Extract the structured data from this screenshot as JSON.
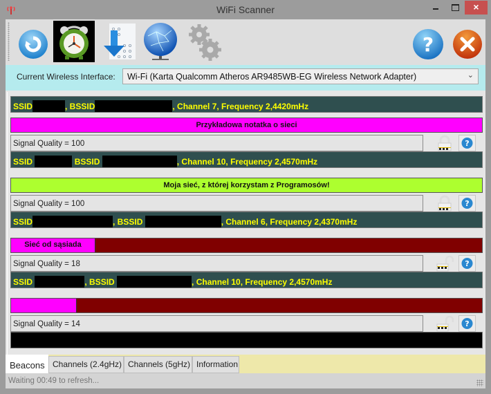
{
  "window": {
    "title": "WiFi Scanner",
    "close_glyph": "×"
  },
  "toolbar": {
    "buttons": [
      {
        "name": "refresh",
        "icon": "refresh-icon"
      },
      {
        "name": "auto-refresh-timer",
        "icon": "alarm-clock-icon"
      },
      {
        "name": "export",
        "icon": "download-icon"
      },
      {
        "name": "network",
        "icon": "globe-icon"
      },
      {
        "name": "settings",
        "icon": "gears-icon"
      },
      {
        "name": "help",
        "icon": "help-icon"
      },
      {
        "name": "exit",
        "icon": "exit-icon"
      }
    ]
  },
  "interface": {
    "label": "Current Wireless Interface:",
    "selected": "Wi-Fi (Karta Qualcomm Atheros AR9485WB-EG Wireless Network Adapter)"
  },
  "networks": [
    {
      "ssid_label": "SSID",
      "bssid_label": ", BSSID",
      "tail": ", Channel 7, Frequency 2,4420mHz",
      "channel": 7,
      "frequency": "2,4420mHz"
    },
    {
      "note": "Przykładowa notatka o sieci",
      "note_color": "#ff00ff",
      "note_style": "full",
      "signal_text": "Signal Quality = 100",
      "signal_quality": 100,
      "lock": "locked",
      "ssid_label": "SSID",
      "bssid_label": "BSSID",
      "tail": ", Channel 10, Frequency 2,4570mHz",
      "channel": 10,
      "frequency": "2,4570mHz"
    },
    {
      "note": "Moja sieć, z której korzystam z Programosów!",
      "note_color": "#adff2f",
      "note_style": "full",
      "signal_text": "Signal Quality = 100",
      "signal_quality": 100,
      "lock": "locked",
      "ssid_label": "SSID",
      "bssid_label": ", BSSID",
      "tail": ", Channel 6, Frequency 2,4370mHz",
      "channel": 6,
      "frequency": "2,4370mHz"
    },
    {
      "note": "Sieć od sąsiada",
      "note_color": "#ff00ff",
      "note_bg": "#800000",
      "note_style": "chip",
      "signal_text": "Signal Quality = 18",
      "signal_quality": 18,
      "lock": "unlocked",
      "ssid_label": "SSID",
      "bssid_label": ", BSSID",
      "tail": ", Channel 10, Frequency 2,4570mHz",
      "channel": 10,
      "frequency": "2,4570mHz"
    },
    {
      "note": "",
      "note_color": "#ff00ff",
      "note_bg": "#800000",
      "note_style": "chip",
      "signal_text": "Signal Quality = 14",
      "signal_quality": 14,
      "lock": "unlocked"
    }
  ],
  "tabs": [
    {
      "label": "Beacons",
      "active": true
    },
    {
      "label": "Channels (2.4gHz)",
      "active": false
    },
    {
      "label": "Channels (5gHz)",
      "active": false
    },
    {
      "label": "Information",
      "active": false
    }
  ],
  "status": {
    "text": "Waiting 00:49 to refresh..."
  },
  "colors": {
    "info_bar_bg": "#2f4f4f",
    "info_bar_text": "#ffff00",
    "interface_bar_bg": "#b5ebee",
    "tabs_bg": "#eee8aa"
  }
}
